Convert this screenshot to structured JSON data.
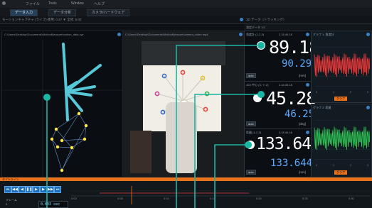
{
  "menubar": {
    "items": [
      "ファイル",
      "Tools",
      "Window",
      "ヘルプ"
    ]
  },
  "tabs": [
    {
      "label": "データ入力"
    },
    {
      "label": "データ分析"
    },
    {
      "label": "カメラ/ハードウェア"
    }
  ],
  "left_header": "モーションキャプチャ (ライブ) 使用: 0.27 ▼ 全体: 5.00",
  "right_header": "3D データ（トラッキング）",
  "right_subheader": "測定データ 1/2",
  "left_panel": {
    "title": "C:\\Users\\Desktop\\Documents\\MotionMeasure\\motion_data.xyz"
  },
  "center_panel": {
    "title": "C:\\Users\\Desktop\\Documents\\MotionMeasure\\camera_video.mp4"
  },
  "readouts": [
    {
      "header": "角度計 (1-2-3)",
      "timestamp": "2.18.46.18",
      "big": "89.18",
      "small": "90.29",
      "unit": "[mm]",
      "button": "auto"
    },
    {
      "header": "AOI 中心 (X, Y, Z)",
      "timestamp": "2.18.46.18",
      "big": "45.28",
      "small": "46.25",
      "unit": "[deg]",
      "button": "auto"
    },
    {
      "header": "距離 (1-2-3)",
      "timestamp": "2.18.46.18",
      "big": "133.644",
      "small": "133.644",
      "unit": "[mm]",
      "button": "auto"
    }
  ],
  "graphs": [
    {
      "title": "グラフ 1: 角度計",
      "color": "#ff3b3b",
      "label": "グラフ",
      "xticks": [
        "0",
        "1",
        "2",
        "3"
      ]
    },
    {
      "title": "グラフ 2: 距離",
      "color": "#30d158",
      "label": "グラフ",
      "xticks": [
        "0",
        "1",
        "2",
        "3"
      ]
    }
  ],
  "timeline": {
    "title": "タイムライン",
    "frame_label": "フレーム",
    "frame_value": "0",
    "time_value": "0.833 sec",
    "ticks": [
      "0:00",
      "0:05",
      "0:10",
      "0:15",
      "0:20",
      "0:25",
      "0:30"
    ]
  },
  "colors": {
    "accent_orange": "#e8731c",
    "teal_marker": "#19b6a4",
    "cyan_trace": "#56c8d8",
    "yellow_dot": "#ffeb3b",
    "blue_value": "#5aa9ff"
  }
}
